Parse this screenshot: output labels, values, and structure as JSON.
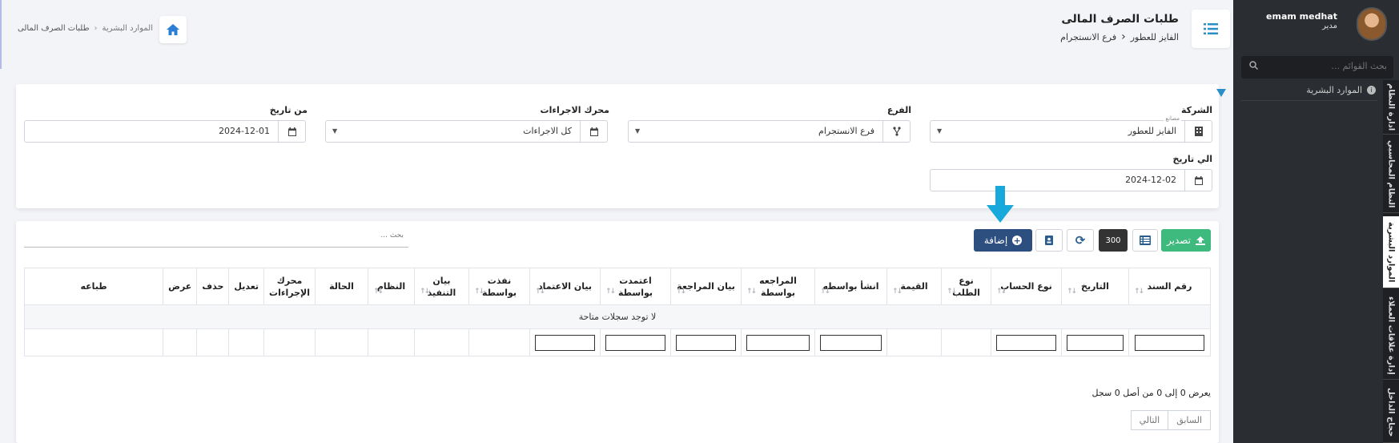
{
  "header": {
    "title": "طلبات الصرف المالى",
    "company": "الفايز للعطور",
    "branch": "فرع الانستجرام",
    "breadcrumb": [
      "الموارد البشرية",
      "طلبات الصرف المالى"
    ]
  },
  "filters": {
    "company_label": "الشركة",
    "company_hint": "مصانع",
    "company_value": "الفايز للعطور",
    "branch_label": "الفرع",
    "branch_value": "فرع الانستجرام",
    "engine_label": "محرك الاجراءات",
    "engine_value": "كل الاجراءات",
    "from_label": "من تاريخ",
    "from_value": "2024-12-01",
    "to_label": "الي تاريخ",
    "to_value": "2024-12-02"
  },
  "toolbar": {
    "export_label": "تصدير",
    "page_size": "300",
    "add_label": "إضافة",
    "search_placeholder": "بحث ..."
  },
  "table": {
    "columns": [
      "رقم السند",
      "التاريخ",
      "نوع الحساب",
      "نوع الطلب",
      "القيمة",
      "انشأ بواسطه",
      "المراجعه بواسطة",
      "بيان المراجعة",
      "اعتمدت بواسطة",
      "بيان الاعتماد",
      "نفذت بواسطة",
      "بيان التنفيذ",
      "النظام",
      "الحالة",
      "محرك الإجراءات",
      "تعديل",
      "حذف",
      "عرض",
      "طباعه"
    ],
    "empty_message": "لا توجد سجلات متاحة",
    "records_info": "يعرض 0 إلى 0 من أصل 0 سجل",
    "prev_label": "السابق",
    "next_label": "التالي"
  },
  "sidebar": {
    "user_name": "emam medhat",
    "user_role": "مدير",
    "search_placeholder": "بحث القوائم ...",
    "menu_item": "الموارد البشرية",
    "tabs": [
      "ادارة النظام",
      "النظام المحاسبي",
      "الموارد البشرية",
      "إدارة علاقات العملاء",
      "حجاج الداخل"
    ]
  },
  "colors": {
    "export": "#3fba7e",
    "add": "#2c4f80",
    "accent": "#2a8ec9",
    "sidebar": "#2a2d31"
  }
}
